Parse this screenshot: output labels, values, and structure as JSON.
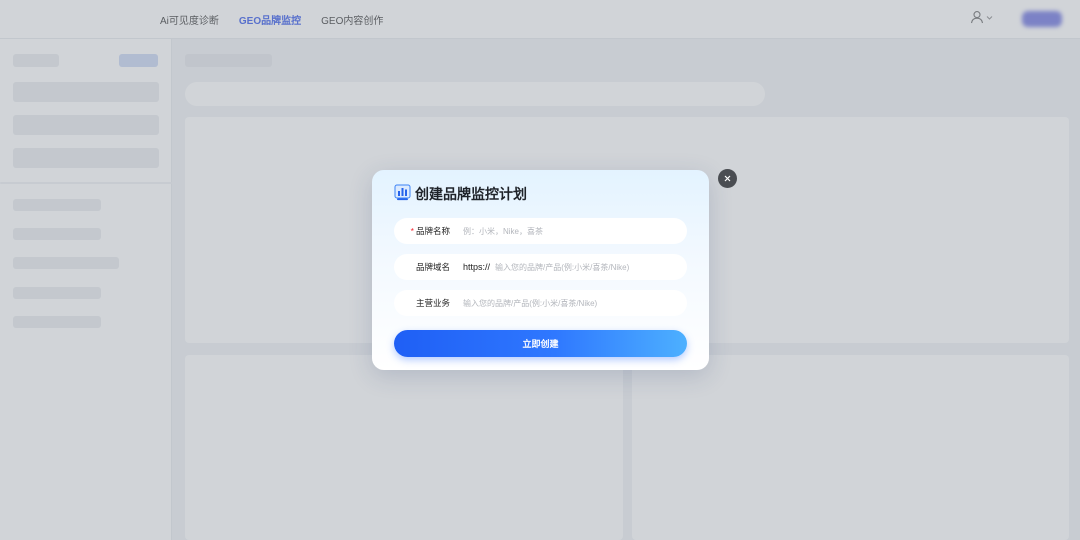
{
  "nav": {
    "items": [
      {
        "label": "Ai可见度诊断",
        "active": false
      },
      {
        "label": "GEO品牌监控",
        "active": true
      },
      {
        "label": "GEO内容创作",
        "active": false
      }
    ]
  },
  "header": {
    "user_icon": "user-icon",
    "dropdown_icon": "chevron-down-icon"
  },
  "modal": {
    "icon": "chart-bar-icon",
    "title": "创建品牌监控计划",
    "close_icon": "close-icon",
    "fields": {
      "brand_name": {
        "required_mark": "*",
        "label": "品牌名称",
        "value": "",
        "placeholder": "例：小米，Nike，喜茶"
      },
      "brand_domain": {
        "label": "品牌域名",
        "prefix": "https://",
        "value": "",
        "placeholder": "输入您的品牌/产品(例:小米/喜茶/Nike)"
      },
      "main_business": {
        "label": "主营业务",
        "value": "",
        "placeholder": "输入您的品牌/产品(例:小米/喜茶/Nike)"
      }
    },
    "submit_label": "立即创建"
  },
  "colors": {
    "accent": "#2f54eb",
    "button_start": "#1f5ff5",
    "button_end": "#4db0ff",
    "required": "#f5222d"
  }
}
